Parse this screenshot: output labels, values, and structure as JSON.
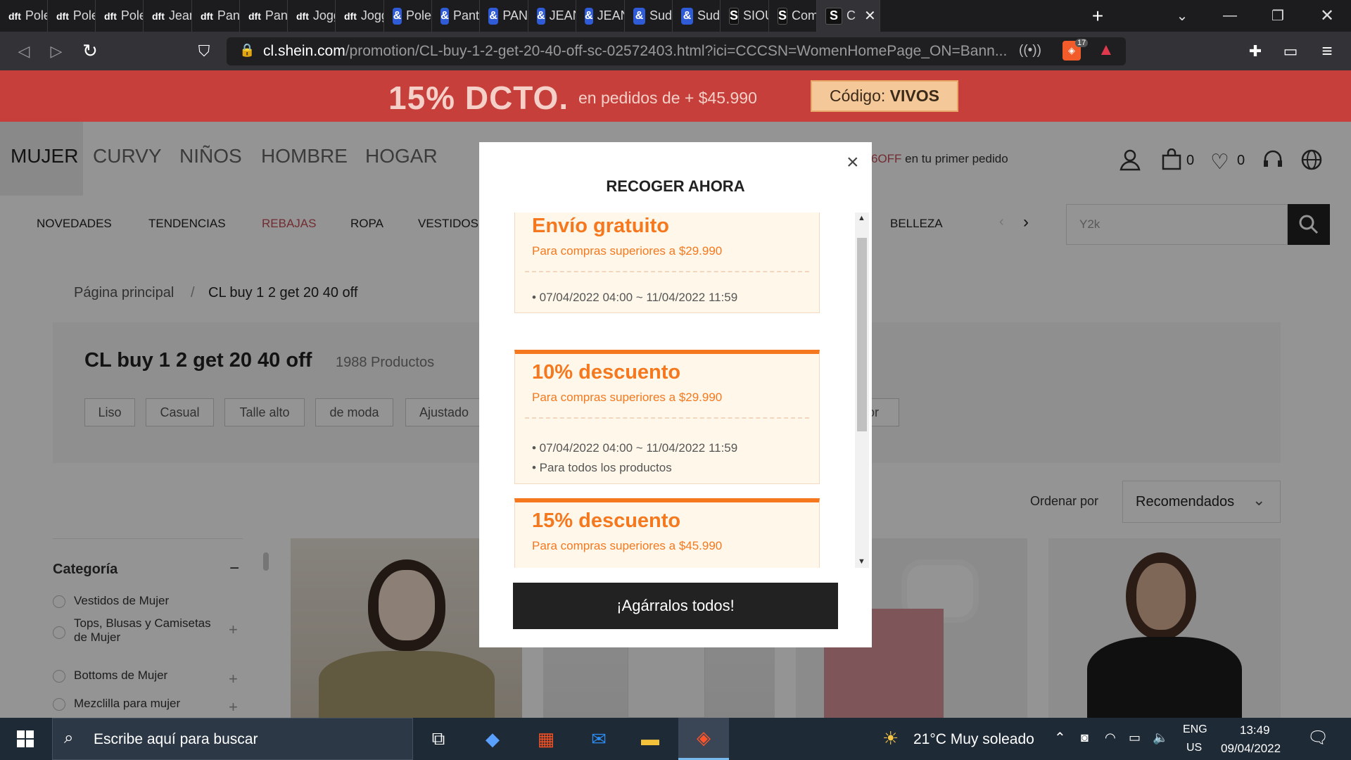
{
  "browser": {
    "tabs": [
      {
        "icon": "dft",
        "label": "Pole"
      },
      {
        "icon": "dft",
        "label": "Pole"
      },
      {
        "icon": "dft",
        "label": "Pole"
      },
      {
        "icon": "dft",
        "label": "Jean"
      },
      {
        "icon": "dft",
        "label": "Pant"
      },
      {
        "icon": "dft",
        "label": "Pant"
      },
      {
        "icon": "dft",
        "label": "Jogg"
      },
      {
        "icon": "dft",
        "label": "Jogg"
      },
      {
        "icon": "&",
        "label": "Pole"
      },
      {
        "icon": "&",
        "label": "Pant"
      },
      {
        "icon": "&",
        "label": "PAN"
      },
      {
        "icon": "&",
        "label": "JEAN"
      },
      {
        "icon": "&",
        "label": "JEAN"
      },
      {
        "icon": "&",
        "label": "Sud"
      },
      {
        "icon": "&",
        "label": "Sud"
      },
      {
        "icon": "S",
        "label": "SIOU"
      },
      {
        "icon": "S",
        "label": "Com"
      },
      {
        "icon": "S",
        "label": "C"
      }
    ],
    "new_tab": "+",
    "url_domain": "cl.shein.com",
    "url_path": "/promotion/CL-buy-1-2-get-20-40-off-sc-02572403.html?ici=CCCSN=WomenHomePage_ON=Bann...",
    "shield_count": "17"
  },
  "promo": {
    "big": "15% DCTO.",
    "mid": "en pedidos de + $45.990",
    "code_label": "Código:",
    "code_value": "VIVOS"
  },
  "header": {
    "genders": [
      "MUJER",
      "CURVY",
      "NIÑOS",
      "HOMBRE",
      "HOGAR"
    ],
    "offer_strong": "6OFF",
    "offer_rest": " en tu primer pedido",
    "cart_count": "0",
    "wish_count": "0"
  },
  "catnav": {
    "items": [
      "NOVEDADES",
      "TENDENCIAS",
      "REBAJAS",
      "ROPA",
      "VESTIDOS"
    ],
    "right_item": "BELLEZA",
    "search_placeholder": "Y2k"
  },
  "page": {
    "breadcrumb_home": "Página principal",
    "breadcrumb_sep": "/",
    "breadcrumb_current": "CL buy 1 2 get 20 40 off",
    "title": "CL buy 1 2 get 20 40 off",
    "count": "1988 Productos",
    "filters": [
      "Liso",
      "Casual",
      "Talle alto",
      "de moda",
      "Ajustado"
    ],
    "filter_cut": "lor",
    "sort_label": "Ordenar por",
    "sort_value": "Recomendados",
    "sidebar_title": "Categoría",
    "sidebar_toggle": "−",
    "categories": [
      {
        "label": "Vestidos de Mujer",
        "expand": ""
      },
      {
        "label": "Tops, Blusas y Camisetas de Mujer",
        "expand": "+"
      },
      {
        "label": "Bottoms de Mujer",
        "expand": "+"
      },
      {
        "label": "Mezclilla para mujer",
        "expand": "+"
      }
    ]
  },
  "modal": {
    "title": "RECOGER AHORA",
    "close": "×",
    "coupons": [
      {
        "title": "Envío gratuito",
        "sub": "Para compras superiores a $29.990",
        "notes": [
          "• 07/04/2022 04:00 ~ 11/04/2022 11:59"
        ]
      },
      {
        "title": "10% descuento",
        "sub": "Para compras superiores a $29.990",
        "notes": [
          "• 07/04/2022 04:00 ~ 11/04/2022 11:59",
          "• Para todos los productos"
        ]
      },
      {
        "title": "15% descuento",
        "sub": "Para compras superiores a $45.990",
        "notes": []
      }
    ],
    "cta": "¡Agárralos todos!"
  },
  "taskbar": {
    "search_placeholder": "Escribe aquí para buscar",
    "weather": "21°C  Muy soleado",
    "lang1": "ENG",
    "lang2": "US",
    "time": "13:49",
    "date": "09/04/2022"
  },
  "colors": {
    "accent_orange": "#f5781f",
    "promo_red": "#c63f3a",
    "sale_red": "#c44d56"
  }
}
